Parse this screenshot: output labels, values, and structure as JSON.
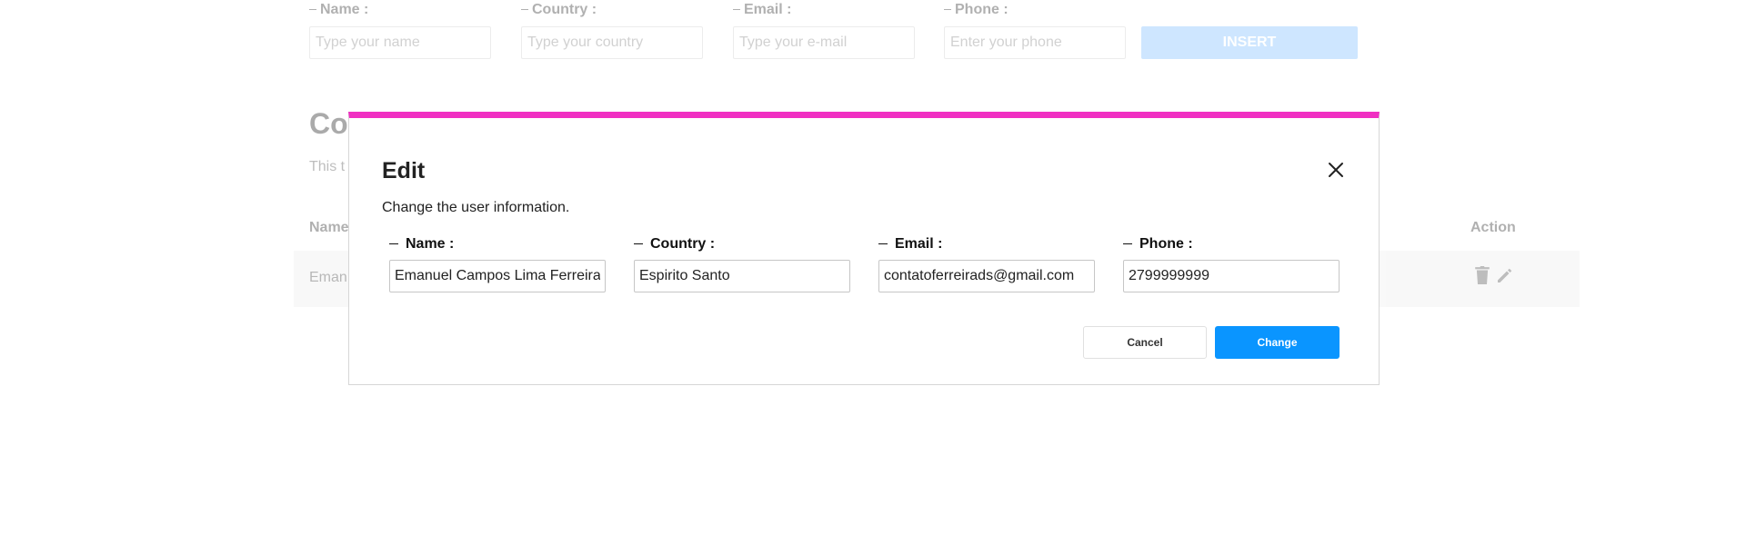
{
  "form": {
    "fields": [
      {
        "label": "Name :",
        "placeholder": "Type your name"
      },
      {
        "label": "Country :",
        "placeholder": "Type your country"
      },
      {
        "label": "Email :",
        "placeholder": "Type your e-mail"
      },
      {
        "label": "Phone :",
        "placeholder": "Enter your phone"
      }
    ],
    "insert_label": "INSERT"
  },
  "contacts": {
    "title_visible": "Co",
    "subtitle_visible": "This t",
    "headers": {
      "name": "Name",
      "action": "Action"
    },
    "rows": [
      {
        "name_visible": "Eman"
      }
    ]
  },
  "icons": {
    "delete": "trash-icon",
    "edit": "pencil-icon",
    "close": "close-icon"
  },
  "colors": {
    "accent_top_border": "#f02fc2",
    "primary_button": "#0a95ff",
    "insert_button": "#7fc0ff"
  },
  "modal": {
    "title": "Edit",
    "description": "Change the user information.",
    "fields": [
      {
        "label": "Name :",
        "value": "Emanuel Campos Lima Ferreira"
      },
      {
        "label": "Country :",
        "value": "Espirito Santo"
      },
      {
        "label": "Email :",
        "value": "contatoferreirads@gmail.com"
      },
      {
        "label": "Phone :",
        "value": "2799999999"
      }
    ],
    "cancel_label": "Cancel",
    "change_label": "Change"
  }
}
